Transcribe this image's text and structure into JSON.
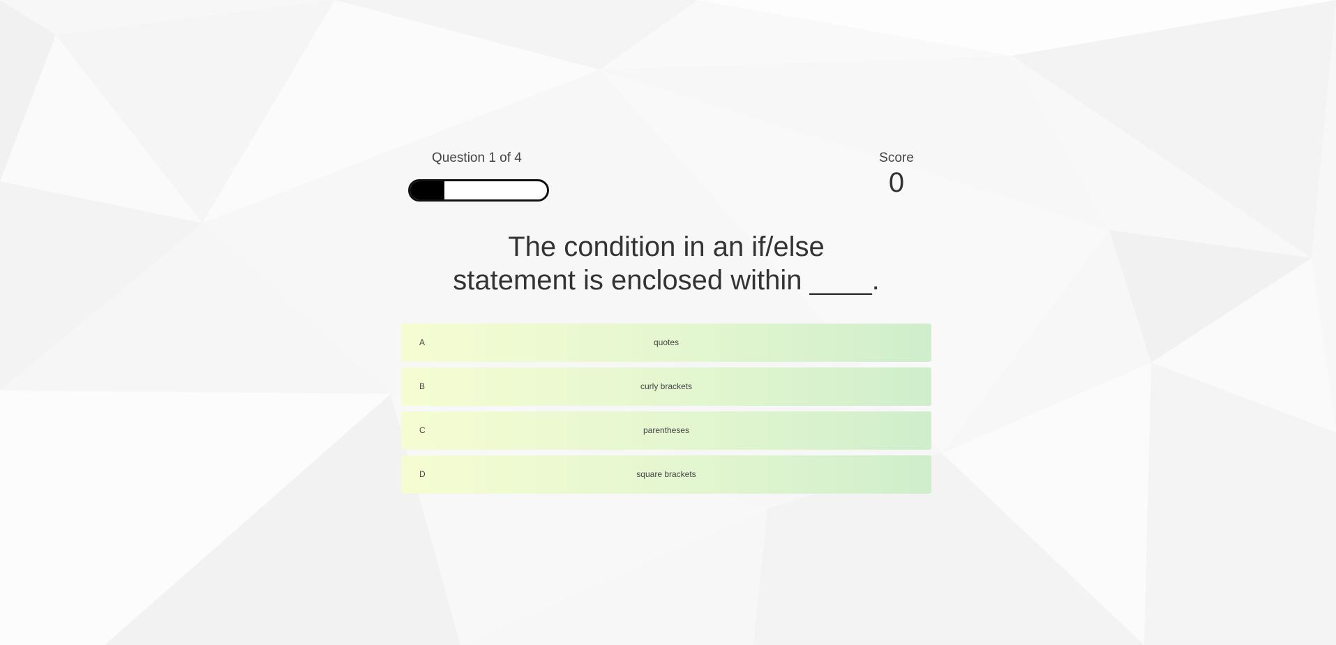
{
  "hud": {
    "question_counter": "Question 1 of 4",
    "progress_fraction": 0.25,
    "score_label": "Score",
    "score_value": "0"
  },
  "question": {
    "text": "The condition in an if/else statement is enclosed within ____."
  },
  "choices": [
    {
      "prefix": "A",
      "text": "quotes"
    },
    {
      "prefix": "B",
      "text": "curly brackets"
    },
    {
      "prefix": "C",
      "text": "parentheses"
    },
    {
      "prefix": "D",
      "text": "square brackets"
    }
  ],
  "colors": {
    "choice_gradient_start": "#f6fcd2",
    "choice_gradient_end": "#cfeecb",
    "progress_fill": "#000000",
    "background": "#f7f7f7"
  }
}
